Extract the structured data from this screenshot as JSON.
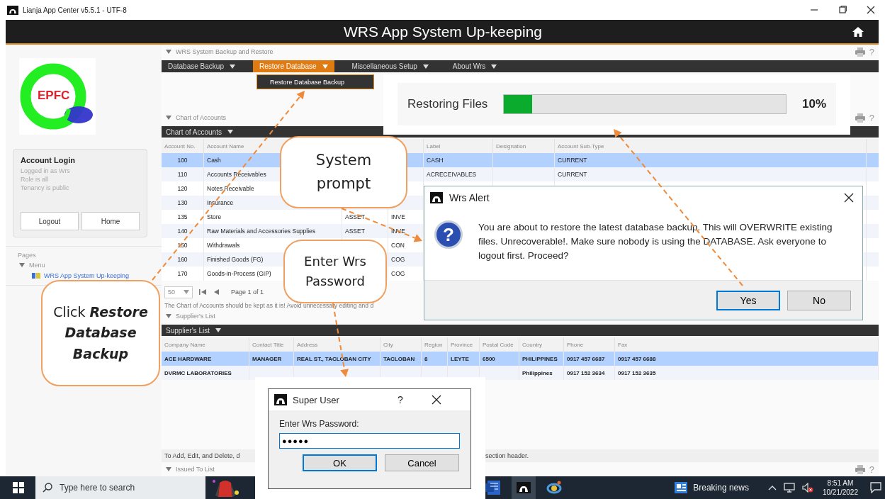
{
  "window": {
    "title": "Lianja App Center v5.5.1 - UTF-8"
  },
  "header": {
    "title": "WRS App System Up-keeping"
  },
  "sidebar": {
    "logo_text": "EPFC",
    "login": {
      "title": "Account Login",
      "lines": [
        "Logged in as Wrs",
        "Role is all",
        "Tenancy is public"
      ],
      "buttons": [
        "Logout",
        "Home"
      ]
    },
    "pages_label": "Pages",
    "menu": {
      "label": "Menu",
      "expanded": true,
      "items": [
        {
          "label": "WRS App System Up-keeping"
        }
      ]
    }
  },
  "backup_section": {
    "title": "WRS System Backup and Restore",
    "expanded": true,
    "help": "?",
    "menus": [
      {
        "label": "Database Backup",
        "selected": false
      },
      {
        "label": "Restore Database",
        "selected": true
      },
      {
        "label": "Miscellaneous Setup",
        "selected": false
      },
      {
        "label": "About Wrs",
        "selected": false
      }
    ],
    "dropdown": [
      "Restore Database Backup"
    ]
  },
  "chart_section": {
    "title": "Chart of Accounts",
    "expanded": true,
    "help": "?",
    "bar_title": "Chart of Accounts",
    "columns": [
      "Account No.",
      "Account Name",
      null,
      null,
      "Label",
      "Designation",
      "Account Sub-Type"
    ],
    "rows": [
      {
        "selected": true,
        "cells": [
          "100",
          "Cash",
          null,
          null,
          "CASH",
          null,
          "CURRENT"
        ]
      },
      {
        "selected": false,
        "cells": [
          "110",
          "Accounts Receivables",
          null,
          null,
          "ACRECEIVABLES",
          null,
          "CURRENT"
        ]
      },
      {
        "selected": false,
        "cells": [
          "120",
          "Notes Receivable",
          null,
          null,
          null,
          null,
          null
        ]
      },
      {
        "selected": false,
        "cells": [
          "130",
          "Insurance",
          null,
          null,
          null,
          null,
          null
        ]
      },
      {
        "selected": false,
        "cells": [
          "135",
          "Store",
          "ASSET",
          "INVE",
          null,
          null,
          null
        ]
      },
      {
        "selected": false,
        "cells": [
          "140",
          "Raw Materials and Accessories Supplies",
          "ASSET",
          "INVE",
          null,
          null,
          null
        ]
      },
      {
        "selected": false,
        "cells": [
          "150",
          "Withdrawals",
          null,
          "CON",
          null,
          null,
          null
        ]
      },
      {
        "selected": false,
        "cells": [
          "160",
          "Finished Goods (FG)",
          null,
          "COG",
          null,
          null,
          null
        ]
      },
      {
        "selected": false,
        "cells": [
          "170",
          "Goods-in-Process (GIP)",
          null,
          "COG",
          null,
          null,
          null
        ]
      }
    ],
    "pager": {
      "page_size": "50",
      "page_label": "Page 1 of 1"
    },
    "note": "The Chart of Accounts should be kept as it is! Avoid unnecessary editing and d"
  },
  "supplier_section": {
    "title": "Supplier's List",
    "expanded": true,
    "bar_title": "Supplier's List",
    "columns": [
      "Company Name",
      "Contact Title",
      "Address",
      "City",
      "Region",
      "Province",
      "Postal Code",
      "Country",
      "Phone",
      "Fax"
    ],
    "rows": [
      {
        "selected": true,
        "cells": [
          "ACE HARDWARE",
          "MANAGER",
          "REAL ST., TACLOBAN CITY",
          "TACLOBAN",
          "8",
          "LEYTE",
          "6500",
          "PHILIPPINES",
          "0917 457 6687",
          "0917 457 6688"
        ]
      },
      {
        "selected": false,
        "cells": [
          "DVRMC LABORATORIES",
          null,
          null,
          null,
          null,
          null,
          null,
          "Philippines",
          "0917 152 3634",
          "0917 152 3635"
        ]
      }
    ],
    "footer_notes": [
      "To Add, Edit, and Delete, d",
      "section header."
    ]
  },
  "issued_section": {
    "title": "Issued To List",
    "expanded": true,
    "help": "?"
  },
  "progress": {
    "label": "Restoring Files",
    "level": 0.1,
    "reading": "10%"
  },
  "alert": {
    "title": "Wrs Alert",
    "icon_glyph": "?",
    "message": "You are about to restore the latest database backup. This will OVERWRITE existing files. Unrecoverable!. Make sure nobody is using the DATABASE. Ask everyone to logout first. Proceed?",
    "buttons": [
      {
        "label": "Yes",
        "focused": true
      },
      {
        "label": "No",
        "focused": false
      }
    ]
  },
  "super_user": {
    "title": "Super User",
    "help": "?",
    "prompt": "Enter Wrs Password:",
    "value": "●●●●●",
    "buttons": [
      {
        "label": "OK",
        "focused": true
      },
      {
        "label": "Cancel",
        "focused": false
      }
    ]
  },
  "callouts": [
    {
      "text": "System prompt"
    },
    {
      "text": "Enter Wrs Password"
    },
    {
      "text": "Click **Restore Database Backup**"
    }
  ],
  "taskbar": {
    "search_placeholder": "Type here to search",
    "news": "Breaking news",
    "time": "8:51 AM",
    "date": "10/21/2022"
  }
}
